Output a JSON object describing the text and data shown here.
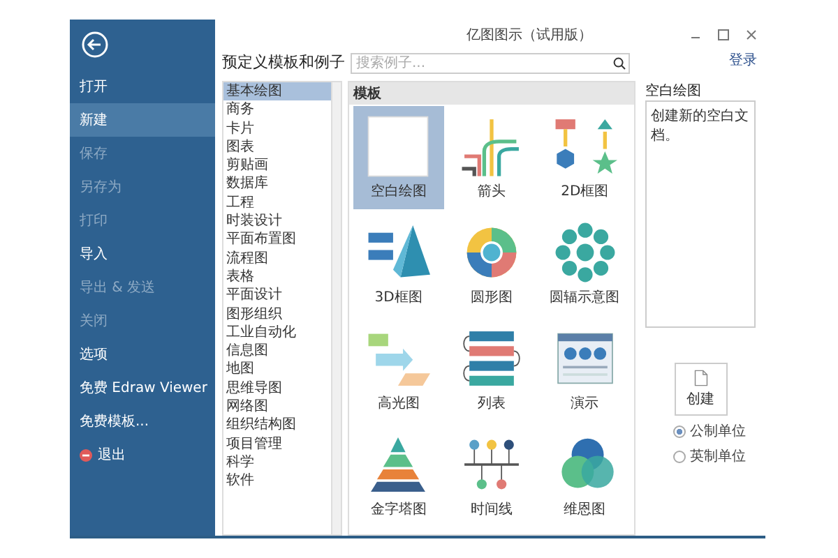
{
  "window": {
    "title": "亿图图示（试用版）",
    "login": "登录"
  },
  "sidebar": {
    "items": [
      {
        "label": "打开",
        "selected": false,
        "disabled": false,
        "kind": "text"
      },
      {
        "label": "新建",
        "selected": true,
        "disabled": false,
        "kind": "text"
      },
      {
        "label": "保存",
        "selected": false,
        "disabled": true,
        "kind": "text"
      },
      {
        "label": "另存为",
        "selected": false,
        "disabled": true,
        "kind": "text"
      },
      {
        "label": "打印",
        "selected": false,
        "disabled": true,
        "kind": "text"
      },
      {
        "label": "导入",
        "selected": false,
        "disabled": false,
        "kind": "text"
      },
      {
        "label": "导出 & 发送",
        "selected": false,
        "disabled": true,
        "kind": "text"
      },
      {
        "label": "关闭",
        "selected": false,
        "disabled": true,
        "kind": "text"
      },
      {
        "label": "选项",
        "selected": false,
        "disabled": false,
        "kind": "text"
      },
      {
        "label": "免费 Edraw Viewer",
        "selected": false,
        "disabled": false,
        "kind": "text"
      },
      {
        "label": "免费模板...",
        "selected": false,
        "disabled": false,
        "kind": "text"
      },
      {
        "label": "退出",
        "selected": false,
        "disabled": false,
        "kind": "exit"
      }
    ]
  },
  "heading": "预定义模板和例子",
  "search": {
    "placeholder": "搜索例子..."
  },
  "categories": [
    {
      "label": "基本绘图",
      "selected": true
    },
    {
      "label": "商务",
      "selected": false
    },
    {
      "label": "卡片",
      "selected": false
    },
    {
      "label": "图表",
      "selected": false
    },
    {
      "label": "剪贴画",
      "selected": false
    },
    {
      "label": "数据库",
      "selected": false
    },
    {
      "label": "工程",
      "selected": false
    },
    {
      "label": "时装设计",
      "selected": false
    },
    {
      "label": "平面布置图",
      "selected": false
    },
    {
      "label": "流程图",
      "selected": false
    },
    {
      "label": "表格",
      "selected": false
    },
    {
      "label": "平面设计",
      "selected": false
    },
    {
      "label": "图形组织",
      "selected": false
    },
    {
      "label": "工业自动化",
      "selected": false
    },
    {
      "label": "信息图",
      "selected": false
    },
    {
      "label": "地图",
      "selected": false
    },
    {
      "label": "思维导图",
      "selected": false
    },
    {
      "label": "网络图",
      "selected": false
    },
    {
      "label": "组织结构图",
      "selected": false
    },
    {
      "label": "项目管理",
      "selected": false
    },
    {
      "label": "科学",
      "selected": false
    },
    {
      "label": "软件",
      "selected": false
    }
  ],
  "gallery": {
    "section": "模板",
    "templates": [
      {
        "label": "空白绘图",
        "kind": "blank",
        "selected": true
      },
      {
        "label": "箭头",
        "kind": "arrows",
        "selected": false
      },
      {
        "label": "2D框图",
        "kind": "block2d",
        "selected": false
      },
      {
        "label": "3D框图",
        "kind": "block3d",
        "selected": false
      },
      {
        "label": "圆形图",
        "kind": "circular",
        "selected": false
      },
      {
        "label": "圆辐示意图",
        "kind": "spoke",
        "selected": false
      },
      {
        "label": "高光图",
        "kind": "highlight",
        "selected": false
      },
      {
        "label": "列表",
        "kind": "list",
        "selected": false
      },
      {
        "label": "演示",
        "kind": "presentation",
        "selected": false
      },
      {
        "label": "金字塔图",
        "kind": "pyramid",
        "selected": false
      },
      {
        "label": "时间线",
        "kind": "timeline",
        "selected": false
      },
      {
        "label": "维恩图",
        "kind": "venn",
        "selected": false
      }
    ]
  },
  "details": {
    "title": "空白绘图",
    "description": "创建新的空白文档。",
    "create": "创建",
    "units": [
      {
        "label": "公制单位",
        "selected": true
      },
      {
        "label": "英制单位",
        "selected": false
      }
    ]
  }
}
